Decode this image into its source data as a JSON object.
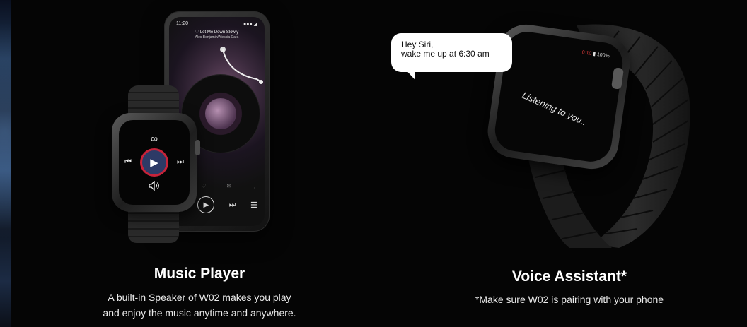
{
  "phone": {
    "time": "11:20",
    "signal": "●●● ◢",
    "song_title": "♡ Let Me Down Slowly",
    "artist": "Alec Benjamin/Alessia Cara",
    "vinyl_text": " "
  },
  "left_watch": {
    "prev": "⏮",
    "play": "▶",
    "next": "⏭",
    "loop": "∞",
    "volume": "🔈"
  },
  "right_watch": {
    "status_rec": "0:10",
    "status_batt": "▮ 100%",
    "listening": "Listening to you.."
  },
  "bubble": {
    "line1": "Hey Siri,",
    "line2": "wake me up at 6:30 am"
  },
  "features": [
    {
      "title": "Music Player",
      "desc_line1": "A built-in Speaker of W02 makes you play",
      "desc_line2": "and enjoy the music anytime and anywhere."
    },
    {
      "title": "Voice Assistant*",
      "desc_line1": "*Make sure W02 is pairing with your phone"
    }
  ]
}
